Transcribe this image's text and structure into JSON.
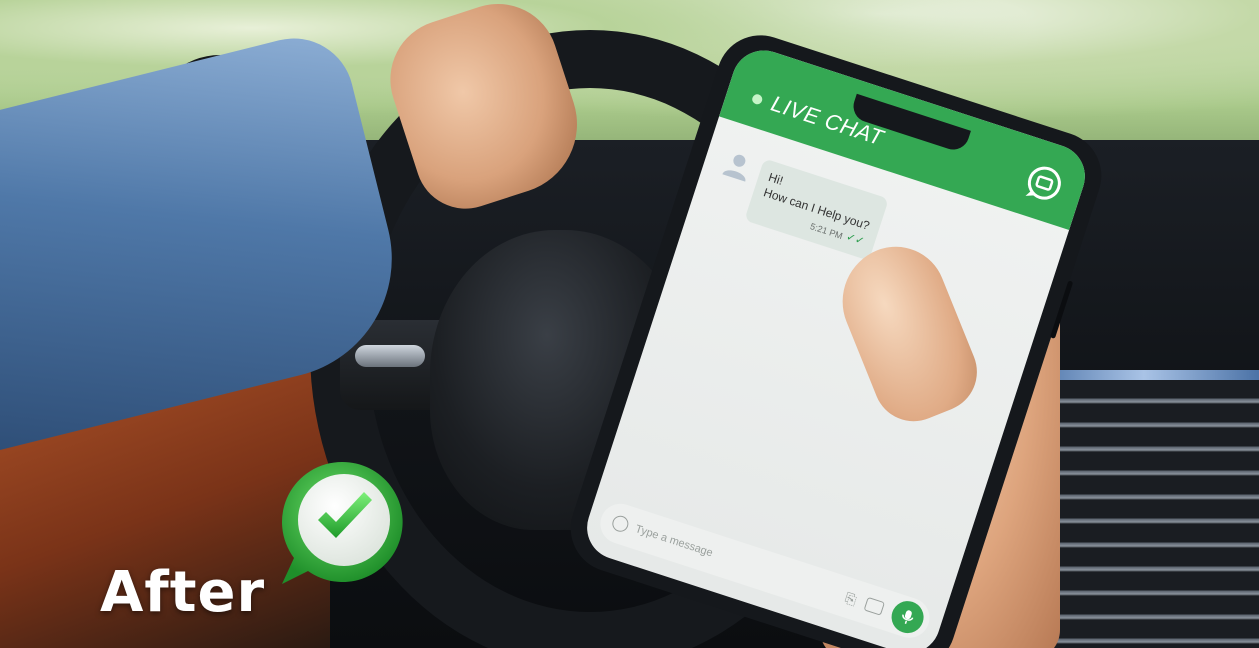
{
  "scene": {
    "label": "After"
  },
  "phone": {
    "header_title": "LIVE CHAT",
    "message_text_line1": "Hi!",
    "message_text_line2": "How can I Help you?",
    "message_time": "5:21 PM",
    "input_placeholder": "Type a message"
  },
  "colors": {
    "accent_green": "#34a853",
    "bubble": "#dde6e1"
  },
  "icons": [
    "chat-bubble-icon",
    "avatar-icon",
    "double-check-icon",
    "emoji-icon",
    "attach-icon",
    "camera-icon",
    "mic-icon",
    "check-badge-icon"
  ]
}
